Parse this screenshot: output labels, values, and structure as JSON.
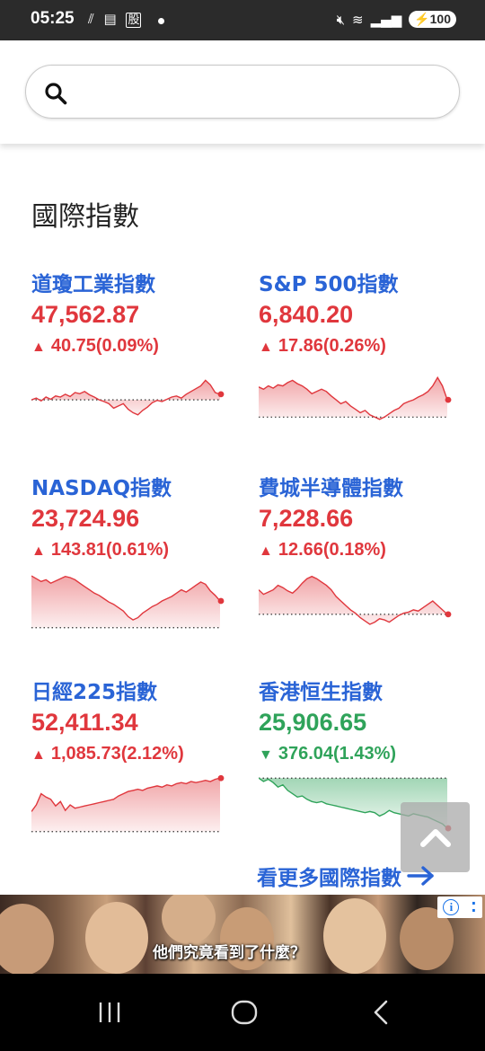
{
  "status": {
    "time": "05:25",
    "notif_badge": "股",
    "battery": "100"
  },
  "search": {
    "placeholder": ""
  },
  "section": {
    "title": "國際指數"
  },
  "indices": [
    {
      "name": "道瓊工業指數",
      "price": "47,562.87",
      "change": "40.75(0.09%)",
      "direction": "up",
      "color": "#e0373d",
      "spark": [
        0.55,
        0.52,
        0.57,
        0.5,
        0.54,
        0.48,
        0.5,
        0.45,
        0.49,
        0.42,
        0.44,
        0.4,
        0.46,
        0.5,
        0.55,
        0.58,
        0.62,
        0.7,
        0.66,
        0.62,
        0.72,
        0.78,
        0.82,
        0.74,
        0.68,
        0.6,
        0.56,
        0.58,
        0.54,
        0.5,
        0.48,
        0.52,
        0.45,
        0.4,
        0.35,
        0.3,
        0.2,
        0.28,
        0.42,
        0.45
      ],
      "baseline": 0.55
    },
    {
      "name": "S&P 500指數",
      "price": "6,840.20",
      "change": "17.86(0.26%)",
      "direction": "up",
      "color": "#e0373d",
      "spark": [
        0.32,
        0.36,
        0.3,
        0.34,
        0.28,
        0.3,
        0.24,
        0.2,
        0.26,
        0.3,
        0.36,
        0.44,
        0.4,
        0.36,
        0.4,
        0.48,
        0.55,
        0.62,
        0.58,
        0.66,
        0.72,
        0.78,
        0.74,
        0.82,
        0.86,
        0.9,
        0.86,
        0.8,
        0.74,
        0.7,
        0.62,
        0.58,
        0.55,
        0.5,
        0.46,
        0.4,
        0.3,
        0.15,
        0.3,
        0.55
      ],
      "baseline": 0.86
    },
    {
      "name": "NASDAQ指數",
      "price": "23,724.96",
      "change": "143.81(0.61%)",
      "direction": "up",
      "color": "#e0373d",
      "spark": [
        0.05,
        0.1,
        0.15,
        0.12,
        0.18,
        0.14,
        0.1,
        0.06,
        0.08,
        0.12,
        0.18,
        0.24,
        0.3,
        0.36,
        0.4,
        0.46,
        0.52,
        0.56,
        0.62,
        0.68,
        0.78,
        0.84,
        0.8,
        0.72,
        0.66,
        0.6,
        0.56,
        0.5,
        0.46,
        0.42,
        0.36,
        0.3,
        0.34,
        0.28,
        0.22,
        0.16,
        0.2,
        0.32,
        0.4,
        0.5
      ],
      "baseline": 0.98
    },
    {
      "name": "費城半導體指數",
      "price": "7,228.66",
      "change": "12.66(0.18%)",
      "direction": "up",
      "color": "#e0373d",
      "spark": [
        0.3,
        0.38,
        0.34,
        0.3,
        0.22,
        0.26,
        0.32,
        0.36,
        0.28,
        0.18,
        0.1,
        0.06,
        0.1,
        0.16,
        0.22,
        0.3,
        0.42,
        0.5,
        0.58,
        0.66,
        0.72,
        0.8,
        0.86,
        0.92,
        0.88,
        0.82,
        0.84,
        0.88,
        0.82,
        0.76,
        0.72,
        0.7,
        0.66,
        0.68,
        0.62,
        0.56,
        0.5,
        0.58,
        0.66,
        0.74
      ],
      "baseline": 0.74
    },
    {
      "name": "日經225指數",
      "price": "52,411.34",
      "change": "1,085.73(2.12%)",
      "direction": "up",
      "color": "#e0373d",
      "spark": [
        0.62,
        0.5,
        0.3,
        0.36,
        0.4,
        0.52,
        0.44,
        0.6,
        0.5,
        0.56,
        0.54,
        0.52,
        0.5,
        0.48,
        0.46,
        0.44,
        0.42,
        0.4,
        0.34,
        0.3,
        0.26,
        0.24,
        0.22,
        0.24,
        0.2,
        0.18,
        0.16,
        0.18,
        0.14,
        0.16,
        0.12,
        0.1,
        0.12,
        0.08,
        0.1,
        0.08,
        0.06,
        0.08,
        0.04,
        0.02
      ],
      "baseline": 0.98
    },
    {
      "name": "香港恒生指數",
      "price": "25,906.65",
      "change": "376.04(1.43%)",
      "direction": "down",
      "color": "#2fa35a",
      "spark": [
        0.02,
        0.08,
        0.04,
        0.1,
        0.18,
        0.14,
        0.24,
        0.3,
        0.36,
        0.34,
        0.4,
        0.44,
        0.46,
        0.44,
        0.48,
        0.5,
        0.52,
        0.54,
        0.56,
        0.58,
        0.6,
        0.62,
        0.64,
        0.62,
        0.64,
        0.7,
        0.66,
        0.6,
        0.64,
        0.66,
        0.68,
        0.7,
        0.66,
        0.68,
        0.7,
        0.72,
        0.76,
        0.8,
        0.84,
        0.92
      ],
      "baseline": 0.02
    }
  ],
  "more_link": "看更多國際指數",
  "ad": {
    "caption": "他們究竟看到了什麼？"
  }
}
